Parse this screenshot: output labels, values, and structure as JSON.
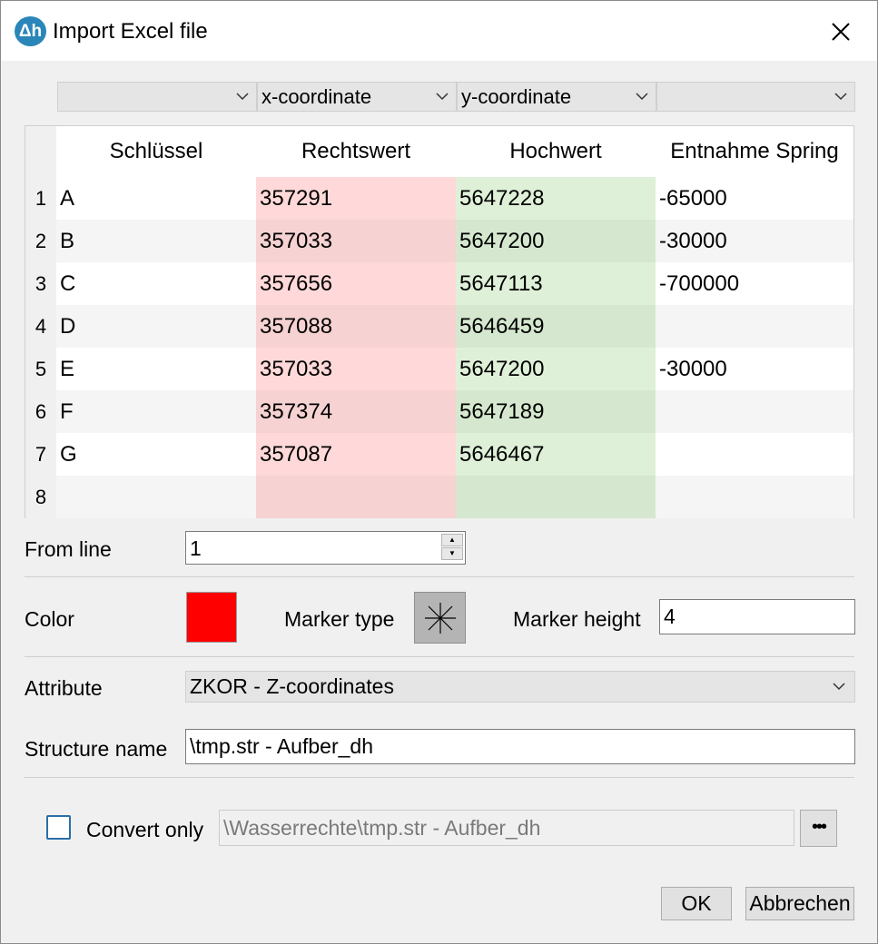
{
  "title": "Import Excel file",
  "app_icon_text": "Δh",
  "column_mappings": [
    "",
    "x-coordinate",
    "y-coordinate",
    ""
  ],
  "table": {
    "headers": [
      "Schlüssel",
      "Rechtswert",
      "Hochwert",
      "Entnahme Spring"
    ],
    "rows": [
      {
        "num": "1",
        "cells": [
          "A",
          "357291",
          "5647228",
          "-65000"
        ]
      },
      {
        "num": "2",
        "cells": [
          "B",
          "357033",
          "5647200",
          "-30000"
        ]
      },
      {
        "num": "3",
        "cells": [
          "C",
          "357656",
          "5647113",
          "-700000"
        ]
      },
      {
        "num": "4",
        "cells": [
          "D",
          "357088",
          "5646459",
          ""
        ]
      },
      {
        "num": "5",
        "cells": [
          "E",
          "357033",
          "5647200",
          "-30000"
        ]
      },
      {
        "num": "6",
        "cells": [
          "F",
          "357374",
          "5647189",
          ""
        ]
      },
      {
        "num": "7",
        "cells": [
          "G",
          "357087",
          "5646467",
          ""
        ]
      },
      {
        "num": "8",
        "cells": [
          "",
          "",
          "",
          ""
        ]
      }
    ]
  },
  "from_line": {
    "label": "From line",
    "value": "1"
  },
  "color": {
    "label": "Color",
    "value": "#ff0000"
  },
  "marker_type": {
    "label": "Marker type",
    "icon": "asterisk-marker-icon"
  },
  "marker_height": {
    "label": "Marker height",
    "value": "4"
  },
  "attribute": {
    "label": "Attribute",
    "value": "ZKOR - Z-coordinates"
  },
  "structure_name": {
    "label": "Structure name",
    "value": "\\tmp.str - Aufber_dh"
  },
  "convert_only": {
    "label": "Convert only",
    "checked": false,
    "path": "\\Wasserrechte\\tmp.str - Aufber_dh"
  },
  "buttons": {
    "browse": "•••",
    "ok": "OK",
    "cancel": "Abbrechen"
  }
}
